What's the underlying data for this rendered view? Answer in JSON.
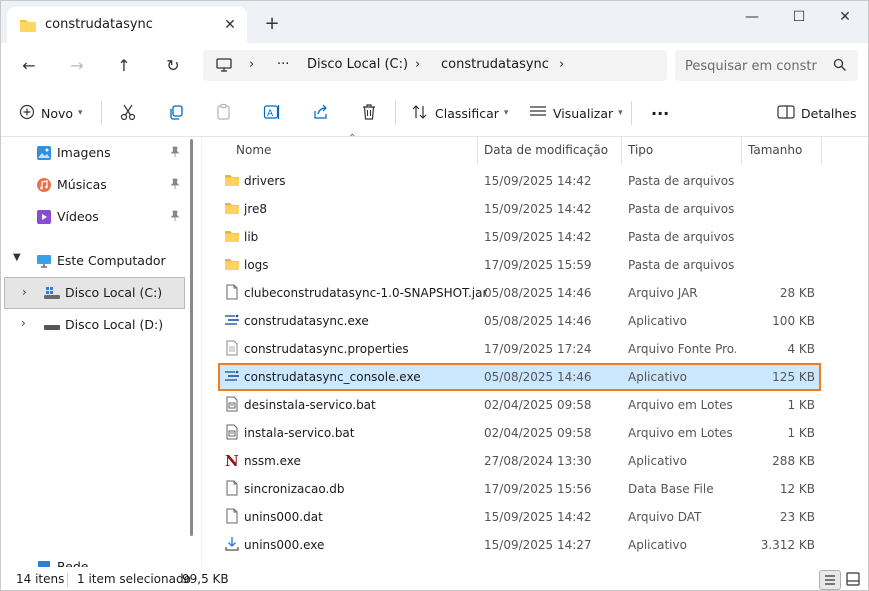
{
  "window": {
    "tab_title": "construdatasync",
    "tab_close": "✕",
    "new_tab": "+",
    "minimize": "—",
    "maximize": "☐",
    "close": "✕"
  },
  "nav": {
    "back": "←",
    "forward": "→",
    "up": "↑",
    "refresh": "↻",
    "breadcrumb_sep": "›",
    "ellipsis": "···",
    "breadcrumb": [
      "Disco Local (C:)",
      "construdatasync"
    ],
    "search_placeholder": "Pesquisar em constr"
  },
  "toolbar": {
    "new_label": "Novo",
    "sort_label": "Classificar",
    "view_label": "Visualizar",
    "more_label": "···",
    "details_label": "Detalhes"
  },
  "sidebar": {
    "items": [
      {
        "label": "Imagens",
        "icon": "pictures-icon",
        "pinned": true
      },
      {
        "label": "Músicas",
        "icon": "music-icon",
        "pinned": true
      },
      {
        "label": "Vídeos",
        "icon": "videos-icon",
        "pinned": true
      },
      {
        "label": "Este Computador",
        "icon": "computer-icon",
        "expanded": true
      },
      {
        "label": "Disco Local (C:)",
        "icon": "drive-icon",
        "selected": true
      },
      {
        "label": "Disco Local (D:)",
        "icon": "drive-icon"
      }
    ],
    "partial_item": "Rede"
  },
  "columns": {
    "name": "Nome",
    "date": "Data de modificação",
    "type": "Tipo",
    "size": "Tamanho"
  },
  "files": [
    {
      "name": "drivers",
      "date": "15/09/2025 14:42",
      "type": "Pasta de arquivos",
      "size": "",
      "icon": "folder"
    },
    {
      "name": "jre8",
      "date": "15/09/2025 14:42",
      "type": "Pasta de arquivos",
      "size": "",
      "icon": "folder"
    },
    {
      "name": "lib",
      "date": "15/09/2025 14:42",
      "type": "Pasta de arquivos",
      "size": "",
      "icon": "folder"
    },
    {
      "name": "logs",
      "date": "17/09/2025 15:59",
      "type": "Pasta de arquivos",
      "size": "",
      "icon": "folder"
    },
    {
      "name": "clubeconstrudatasync-1.0-SNAPSHOT.jar",
      "date": "05/08/2025 14:46",
      "type": "Arquivo JAR",
      "size": "28 KB",
      "icon": "file"
    },
    {
      "name": "construdatasync.exe",
      "date": "05/08/2025 14:46",
      "type": "Aplicativo",
      "size": "100 KB",
      "icon": "exe"
    },
    {
      "name": "construdatasync.properties",
      "date": "17/09/2025 17:24",
      "type": "Arquivo Fonte Pro...",
      "size": "4 KB",
      "icon": "textfile"
    },
    {
      "name": "construdatasync_console.exe",
      "date": "05/08/2025 14:46",
      "type": "Aplicativo",
      "size": "125 KB",
      "icon": "exe",
      "selected": true
    },
    {
      "name": "desinstala-servico.bat",
      "date": "02/04/2025 09:58",
      "type": "Arquivo em Lotes ...",
      "size": "1 KB",
      "icon": "bat"
    },
    {
      "name": "instala-servico.bat",
      "date": "02/04/2025 09:58",
      "type": "Arquivo em Lotes ...",
      "size": "1 KB",
      "icon": "bat"
    },
    {
      "name": "nssm.exe",
      "date": "27/08/2024 13:30",
      "type": "Aplicativo",
      "size": "288 KB",
      "icon": "nssm"
    },
    {
      "name": "sincronizacao.db",
      "date": "17/09/2025 15:56",
      "type": "Data Base File",
      "size": "12 KB",
      "icon": "file"
    },
    {
      "name": "unins000.dat",
      "date": "15/09/2025 14:42",
      "type": "Arquivo DAT",
      "size": "23 KB",
      "icon": "file"
    },
    {
      "name": "unins000.exe",
      "date": "15/09/2025 14:27",
      "type": "Aplicativo",
      "size": "3.312 KB",
      "icon": "installer"
    }
  ],
  "status": {
    "count": "14 itens",
    "selection": "1 item selecionado",
    "selection_size": "99,5 KB"
  },
  "colors": {
    "selection_bg": "#cce8ff",
    "selection_border": "#f07c22",
    "folder": "#f5c542",
    "accent": "#0067c0"
  }
}
